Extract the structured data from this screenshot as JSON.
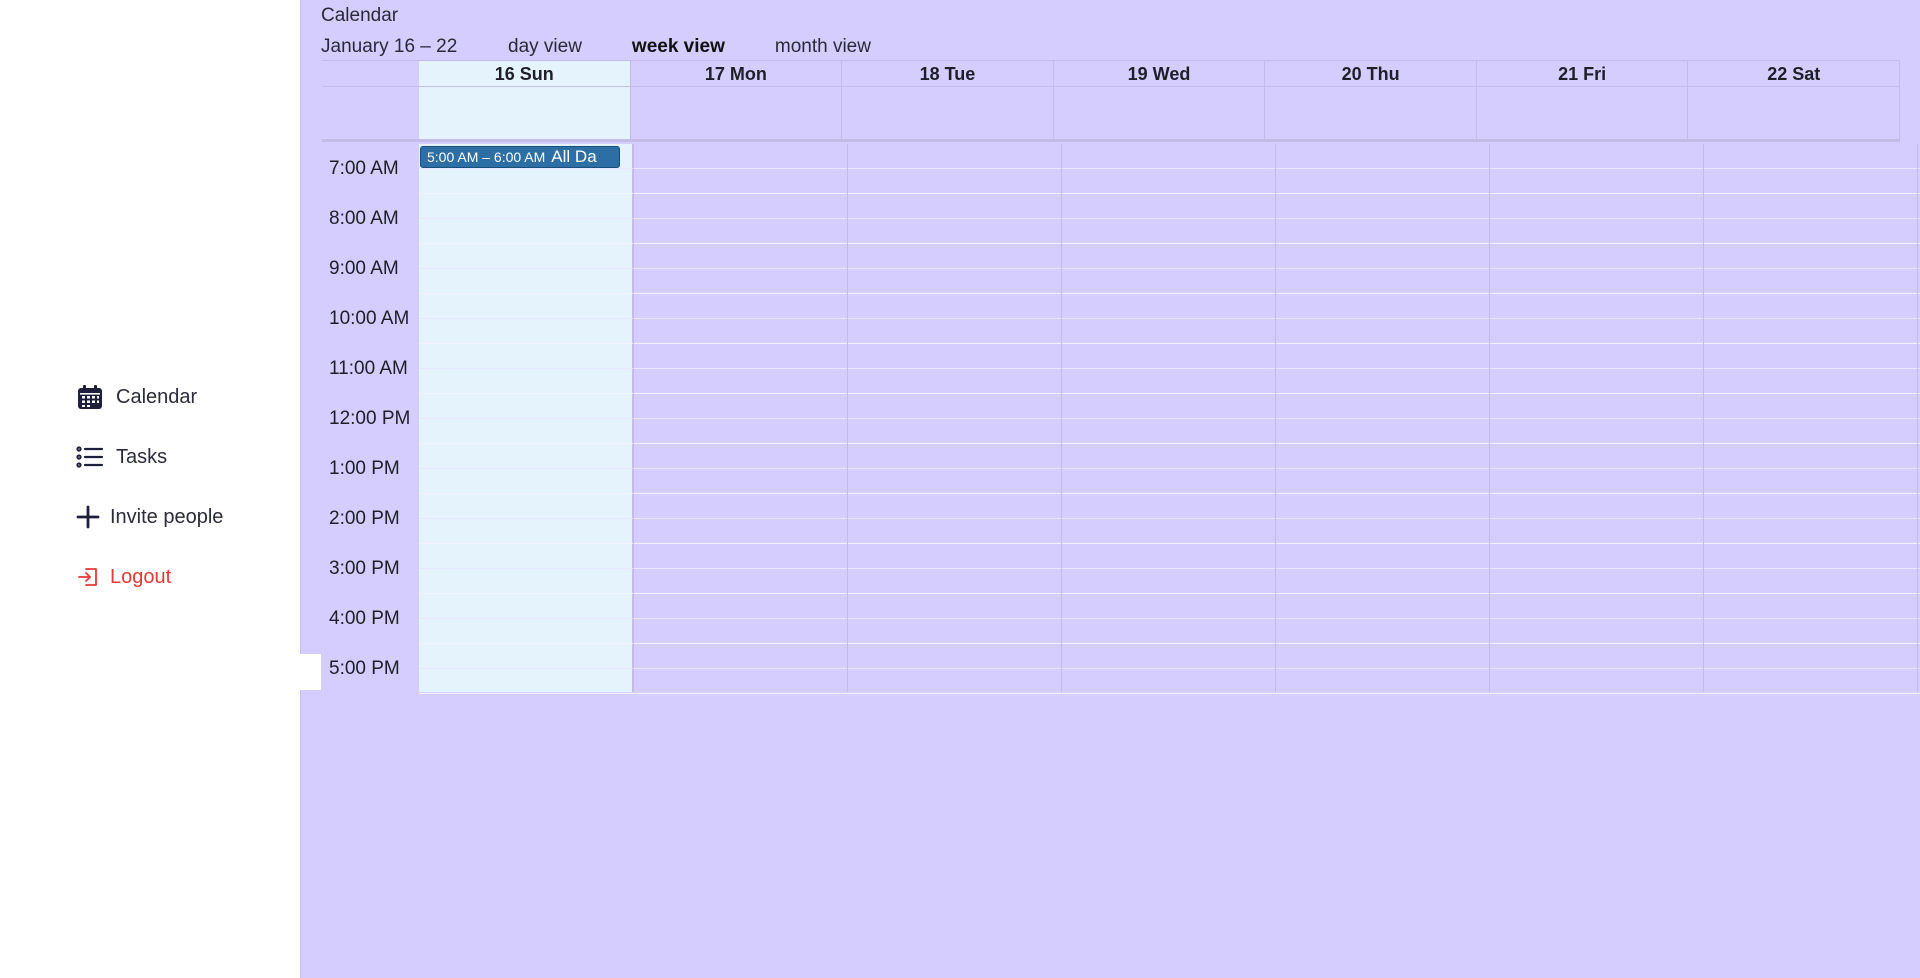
{
  "sidebar": {
    "items": [
      {
        "label": "Calendar",
        "icon": "calendar-icon"
      },
      {
        "label": "Tasks",
        "icon": "list-icon"
      },
      {
        "label": "Invite people",
        "icon": "plus-icon"
      },
      {
        "label": "Logout",
        "icon": "logout-icon"
      }
    ]
  },
  "header": {
    "title": "Calendar",
    "range": "January 16 – 22",
    "views": [
      "day view",
      "week view",
      "month view"
    ],
    "active_view": "week view"
  },
  "week": {
    "days": [
      "16 Sun",
      "17 Mon",
      "18 Tue",
      "19 Wed",
      "20 Thu",
      "21 Fri",
      "22 Sat"
    ],
    "today_index": 0
  },
  "times": [
    "7:00 AM",
    "8:00 AM",
    "9:00 AM",
    "10:00 AM",
    "11:00 AM",
    "12:00 PM",
    "1:00 PM",
    "2:00 PM",
    "3:00 PM",
    "4:00 PM",
    "5:00 PM"
  ],
  "events": [
    {
      "time": "5:00 AM – 6:00 AM",
      "title": "All Da",
      "day_index": 0
    }
  ],
  "colors": {
    "background": "#d4cdfd",
    "today": "#e5f3fc",
    "event": "#2d6ea4",
    "logout": "#e53935"
  }
}
